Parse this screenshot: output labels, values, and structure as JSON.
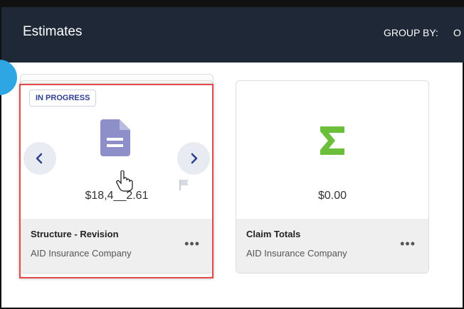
{
  "header": {
    "title": "Estimates",
    "group_by_label": "GROUP BY:",
    "group_by_value": "O"
  },
  "cards": [
    {
      "status_badge": "IN PROGRESS",
      "icon": "document-icon",
      "amount": "$18,4__2.61",
      "name": "Structure - Revision",
      "company": "AID Insurance Company",
      "more": "•••"
    },
    {
      "icon": "sigma-icon",
      "amount": "$0.00",
      "name": "Claim Totals",
      "company": "AID Insurance Company",
      "more": "•••"
    }
  ],
  "colors": {
    "header_bg": "#1f2836",
    "doc_icon": "#8e8fc8",
    "sigma_icon": "#6bbf3a",
    "badge_text": "#2e3f8f",
    "highlight": "#e24a4a"
  }
}
